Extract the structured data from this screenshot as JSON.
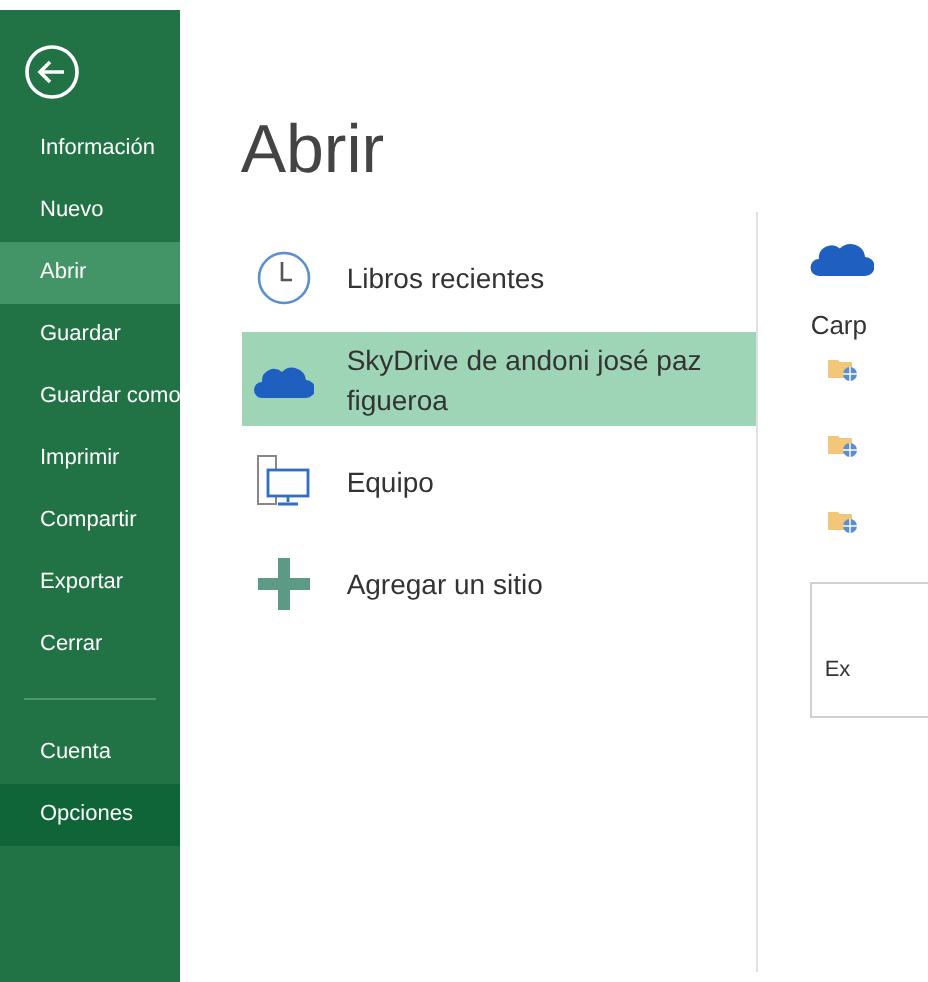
{
  "sidebar": {
    "items": [
      {
        "label": "Información",
        "selected": false,
        "kind": "item"
      },
      {
        "label": "Nuevo",
        "selected": false,
        "kind": "item"
      },
      {
        "label": "Abrir",
        "selected": true,
        "kind": "item"
      },
      {
        "label": "Guardar",
        "selected": false,
        "kind": "item"
      },
      {
        "label": "Guardar como",
        "selected": false,
        "kind": "item"
      },
      {
        "label": "Imprimir",
        "selected": false,
        "kind": "item"
      },
      {
        "label": "Compartir",
        "selected": false,
        "kind": "item"
      },
      {
        "label": "Exportar",
        "selected": false,
        "kind": "item"
      },
      {
        "label": "Cerrar",
        "selected": false,
        "kind": "item"
      },
      {
        "label": "Cuenta",
        "selected": false,
        "kind": "item"
      },
      {
        "label": "Opciones",
        "selected": false,
        "kind": "hovered"
      }
    ]
  },
  "title": "Abrir",
  "places": [
    {
      "label": "Libros recientes",
      "selected": false,
      "kind": "recent"
    },
    {
      "label": "SkyDrive de andoni josé paz figueroa",
      "selected": true,
      "kind": "cloud"
    },
    {
      "label": "Equipo",
      "selected": false,
      "kind": "computer"
    },
    {
      "label": "Agregar un sitio",
      "selected": false,
      "kind": "add"
    }
  ],
  "detail": {
    "heading": "Carp",
    "folders": [
      {
        "kind": "web-folder"
      },
      {
        "kind": "web-folder"
      },
      {
        "kind": "web-folder"
      }
    ],
    "browse_label": "Ex"
  }
}
